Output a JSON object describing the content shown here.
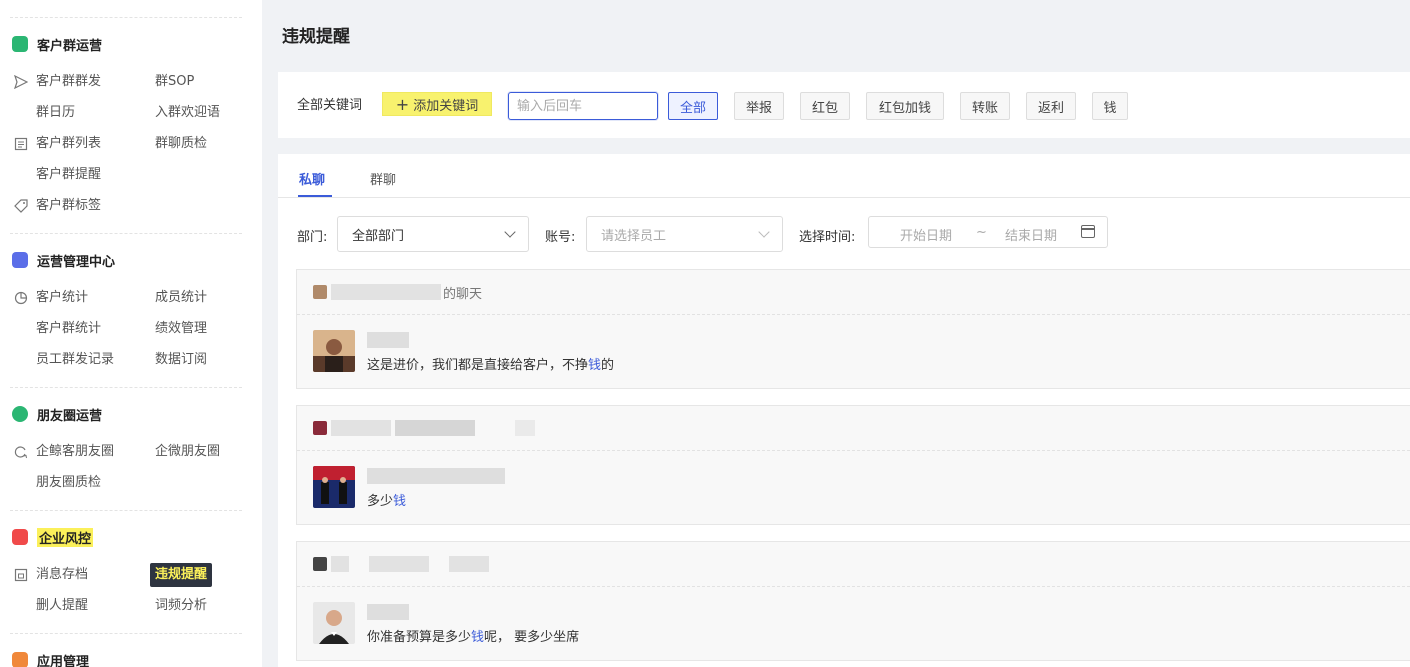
{
  "sidebar": {
    "sections": [
      {
        "title": "客户群运营",
        "color": "#2bb673",
        "items": [
          "客户群群发",
          "群SOP",
          "群日历",
          "入群欢迎语",
          "客户群列表",
          "群聊质检",
          "客户群提醒",
          "客户群标签"
        ]
      },
      {
        "title": "运营管理中心",
        "color": "#5b6ee8",
        "items": [
          "客户统计",
          "成员统计",
          "客户群统计",
          "绩效管理",
          "员工群发记录",
          "数据订阅"
        ]
      },
      {
        "title": "朋友圈运营",
        "color": "#2bb673",
        "items": [
          "企鲸客朋友圈",
          "企微朋友圈",
          "朋友圈质检"
        ]
      },
      {
        "title": "企业风控",
        "color": "#f04a4a",
        "items": [
          "消息存档",
          "违规提醒",
          "删人提醒",
          "词频分析"
        ]
      },
      {
        "title": "应用管理",
        "color": "#f0883a",
        "items": []
      }
    ],
    "active_item": "违规提醒"
  },
  "page": {
    "title": "违规提醒"
  },
  "keywords": {
    "label": "全部关键词",
    "add_button": "添加关键词",
    "input_placeholder": "输入后回车",
    "tags": [
      "全部",
      "举报",
      "红包",
      "红包加钱",
      "转账",
      "返利",
      "钱"
    ],
    "selected": "全部"
  },
  "tabs": {
    "items": [
      "私聊",
      "群聊"
    ],
    "active": "私聊"
  },
  "filters": {
    "dept_label": "部门:",
    "dept_value": "全部部门",
    "account_label": "账号:",
    "account_placeholder": "请选择员工",
    "time_label": "选择时间:",
    "start_placeholder": "开始日期",
    "range_sep": "~",
    "end_placeholder": "结束日期"
  },
  "messages": [
    {
      "title_suffix": "的聊天",
      "pre": "这是进价，我们都是直接给客户，不挣",
      "keyword": "钱",
      "post": "的"
    },
    {
      "title_suffix": "",
      "pre": "多少",
      "keyword": "钱",
      "post": ""
    },
    {
      "title_suffix": "",
      "pre": "你准备预算是多少",
      "keyword": "钱",
      "post": "呢， 要多少坐席"
    }
  ]
}
